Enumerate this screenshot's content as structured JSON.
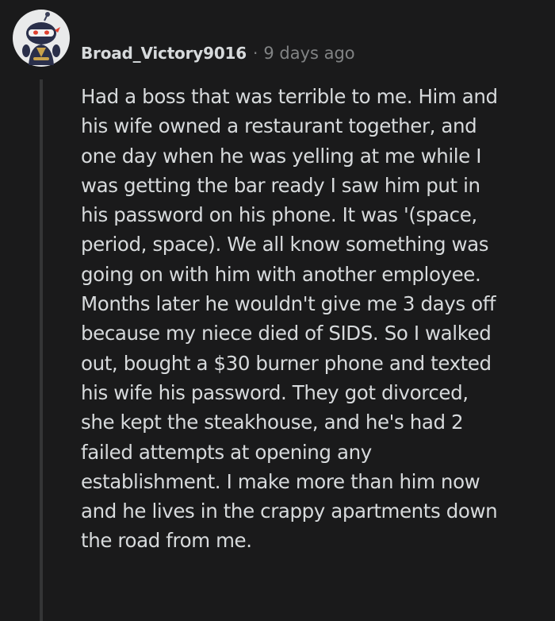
{
  "comment": {
    "author": "Broad_Victory9016",
    "separator": "·",
    "timestamp": "9 days ago",
    "avatar_icon": "snoo-avatar-icon",
    "body_lines": [
      "Had a boss that was terrible to me. Him and",
      "his wife owned a restaurant together, and",
      "one day when he was yelling at me while I",
      "was getting the bar ready I saw him put in",
      "his password on his phone. It was '(space,",
      "period, space). We all know something was",
      "going on with him with another employee.",
      "Months later he wouldn't give me 3 days off",
      "because my niece died of SIDS. So I walked",
      "out, bought a $30 burner phone and texted",
      "his wife his password. They got divorced,",
      "she kept the steakhouse, and he's had 2",
      "failed attempts at opening any",
      "establishment. I make more than him now",
      "and he lives in the crappy apartments down",
      "the road from me."
    ]
  },
  "colors": {
    "background": "#1a1a1b",
    "text": "#d7dadc",
    "meta": "#818384",
    "thread_line": "#343536"
  }
}
